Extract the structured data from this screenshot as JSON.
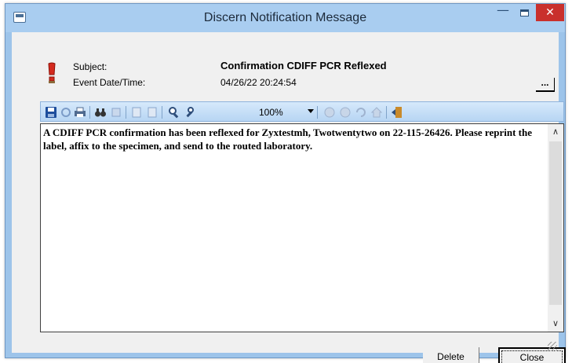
{
  "window": {
    "title": "Discern Notification Message",
    "minimize_glyph": "—",
    "close_glyph": "✕"
  },
  "header": {
    "subject_label": "Subject:",
    "subject_value": "Confirmation CDIFF PCR Reflexed",
    "date_label": "Event Date/Time:",
    "date_value": "04/26/22 20:24:54",
    "more_button": "..."
  },
  "toolbar": {
    "zoom": "100%",
    "icons": [
      "save-icon",
      "refresh-icon",
      "print-icon",
      "find-icon",
      "find-next-icon",
      "page-setup-icon",
      "page-icon",
      "zoom-in-icon",
      "zoom-out-icon",
      "back-icon",
      "forward-icon",
      "refresh-page-icon",
      "home-icon",
      "exit-icon"
    ]
  },
  "message": {
    "body": "A CDIFF PCR confirmation has been reflexed for Zyxtestmh, Twotwentytwo on 22-115-26426. Please reprint the label, affix to the specimen, and send to the routed laboratory."
  },
  "scroll": {
    "up": "∧",
    "down": "∨"
  },
  "buttons": {
    "delete": "Delete",
    "close": "Close"
  },
  "colors": {
    "titlebar": "#a9cdf0",
    "close_red": "#c9302c",
    "toolbar": "#c3ddf6"
  }
}
